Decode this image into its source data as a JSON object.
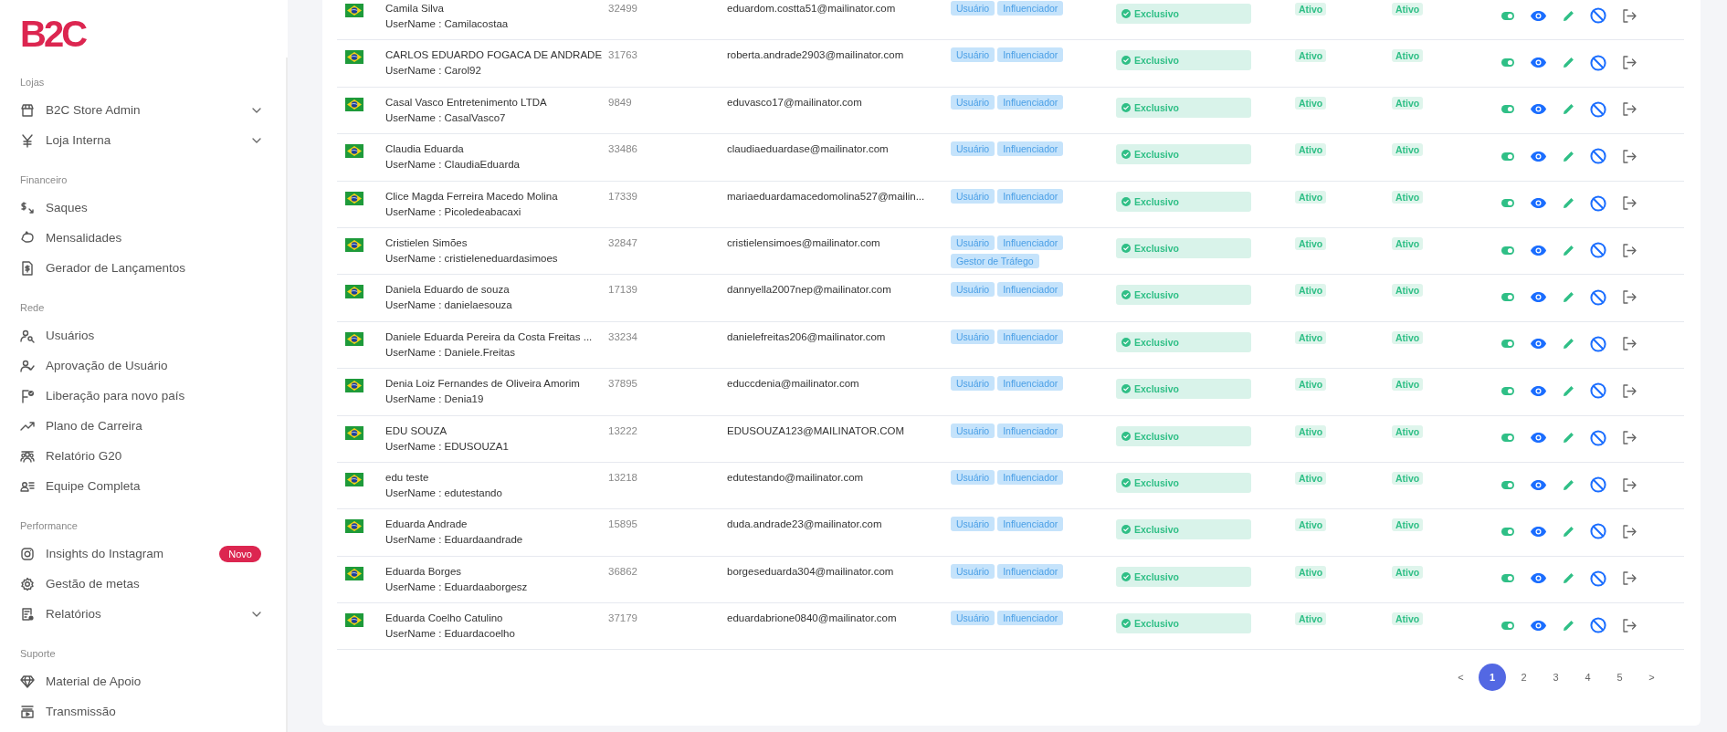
{
  "sidebar": {
    "logo": "B2C",
    "sections": [
      {
        "label": "Lojas",
        "items": [
          {
            "label": "B2C Store Admin",
            "expandable": true
          },
          {
            "label": "Loja Interna",
            "expandable": true
          }
        ]
      },
      {
        "label": "Financeiro",
        "items": [
          {
            "label": "Saques",
            "expandable": false
          },
          {
            "label": "Mensalidades",
            "expandable": false
          },
          {
            "label": "Gerador de Lançamentos",
            "expandable": false
          }
        ]
      },
      {
        "label": "Rede",
        "items": [
          {
            "label": "Usuários",
            "expandable": false
          },
          {
            "label": "Aprovação de Usuário",
            "expandable": false
          },
          {
            "label": "Liberação para novo país",
            "expandable": false
          },
          {
            "label": "Plano de Carreira",
            "expandable": false
          },
          {
            "label": "Relatório G20",
            "expandable": false
          },
          {
            "label": "Equipe Completa",
            "expandable": false
          }
        ]
      },
      {
        "label": "Performance",
        "items": [
          {
            "label": "Insights do Instagram",
            "expandable": false,
            "badge": "Novo"
          },
          {
            "label": "Gestão de metas",
            "expandable": false
          },
          {
            "label": "Relatórios",
            "expandable": true
          }
        ]
      },
      {
        "label": "Suporte",
        "items": [
          {
            "label": "Material de Apoio",
            "expandable": false
          },
          {
            "label": "Transmissão",
            "expandable": false
          }
        ]
      }
    ]
  },
  "table": {
    "rows": [
      {
        "name": "Camila Silva",
        "username": "UserName : Camilacostaa",
        "number": "32499",
        "email": "eduardom.costta51@mailinator.com",
        "roles": [
          "Usuário",
          "Influenciador"
        ],
        "label": "Exclusivo",
        "status_1": "Ativo",
        "status_2": "Ativo",
        "toggle_on": true
      },
      {
        "name": "CARLOS EDUARDO FOGACA DE ANDRADE",
        "username": "UserName : Carol92",
        "number": "31763",
        "email": "roberta.andrade2903@mailinator.com",
        "roles": [
          "Usuário",
          "Influenciador"
        ],
        "label": "Exclusivo",
        "status_1": "Ativo",
        "status_2": "Ativo",
        "toggle_on": true
      },
      {
        "name": "Casal Vasco Entretenimento LTDA",
        "username": "UserName : CasalVasco7",
        "number": "9849",
        "email": "eduvasco17@mailinator.com",
        "roles": [
          "Usuário",
          "Influenciador"
        ],
        "label": "Exclusivo",
        "status_1": "Ativo",
        "status_2": "Ativo",
        "toggle_on": true
      },
      {
        "name": "Claudia Eduarda",
        "username": "UserName : ClaudiaEduarda",
        "number": "33486",
        "email": "claudiaeduardase@mailinator.com",
        "roles": [
          "Usuário",
          "Influenciador"
        ],
        "label": "Exclusivo",
        "status_1": "Ativo",
        "status_2": "Ativo",
        "toggle_on": true
      },
      {
        "name": "Clice Magda Ferreira Macedo Molina",
        "username": "UserName : Picoledeabacaxi",
        "number": "17339",
        "email": "mariaeduardamacedomolina527@mailin...",
        "roles": [
          "Usuário",
          "Influenciador"
        ],
        "label": "Exclusivo",
        "status_1": "Ativo",
        "status_2": "Ativo",
        "toggle_on": true
      },
      {
        "name": "Cristielen Simões",
        "username": "UserName : cristieleneduardasimoes",
        "number": "32847",
        "email": "cristielensimoes@mailinator.com",
        "roles": [
          "Usuário",
          "Influenciador",
          "Gestor de Tráfego"
        ],
        "label": "Exclusivo",
        "status_1": "Ativo",
        "status_2": "Ativo",
        "toggle_on": true
      },
      {
        "name": "Daniela Eduardo de souza",
        "username": "UserName : danielaesouza",
        "number": "17139",
        "email": "dannyella2007nep@mailinator.com",
        "roles": [
          "Usuário",
          "Influenciador"
        ],
        "label": "Exclusivo",
        "status_1": "Ativo",
        "status_2": "Ativo",
        "toggle_on": true
      },
      {
        "name": "Daniele Eduarda Pereira da Costa Freitas ...",
        "username": "UserName : Daniele.Freitas",
        "number": "33234",
        "email": "danielefreitas206@mailinator.com",
        "roles": [
          "Usuário",
          "Influenciador"
        ],
        "label": "Exclusivo",
        "status_1": "Ativo",
        "status_2": "Ativo",
        "toggle_on": true
      },
      {
        "name": "Denia Loiz Fernandes de Oliveira Amorim",
        "username": "UserName : Denia19",
        "number": "37895",
        "email": "educcdenia@mailinator.com",
        "roles": [
          "Usuário",
          "Influenciador"
        ],
        "label": "Exclusivo",
        "status_1": "Ativo",
        "status_2": "Ativo",
        "toggle_on": true
      },
      {
        "name": "EDU SOUZA",
        "username": "UserName : EDUSOUZA1",
        "number": "13222",
        "email": "EDUSOUZA123@MAILINATOR.COM",
        "roles": [
          "Usuário",
          "Influenciador"
        ],
        "label": "Exclusivo",
        "status_1": "Ativo",
        "status_2": "Ativo",
        "toggle_on": true
      },
      {
        "name": "edu teste",
        "username": "UserName : edutestando",
        "number": "13218",
        "email": "edutestando@mailinator.com",
        "roles": [
          "Usuário",
          "Influenciador"
        ],
        "label": "Exclusivo",
        "status_1": "Ativo",
        "status_2": "Ativo",
        "toggle_on": true
      },
      {
        "name": "Eduarda Andrade",
        "username": "UserName : Eduardaandrade",
        "number": "15895",
        "email": "duda.andrade23@mailinator.com",
        "roles": [
          "Usuário",
          "Influenciador"
        ],
        "label": "Exclusivo",
        "status_1": "Ativo",
        "status_2": "Ativo",
        "toggle_on": true
      },
      {
        "name": "Eduarda Borges",
        "username": "UserName : Eduardaaborgesz",
        "number": "36862",
        "email": "borgeseduarda304@mailinator.com",
        "roles": [
          "Usuário",
          "Influenciador"
        ],
        "label": "Exclusivo",
        "status_1": "Ativo",
        "status_2": "Ativo",
        "toggle_on": true
      },
      {
        "name": "Eduarda Coelho Catulino",
        "username": "UserName : Eduardacoelho",
        "number": "37179",
        "email": "eduardabrione0840@mailinator.com",
        "roles": [
          "Usuário",
          "Influenciador"
        ],
        "label": "Exclusivo",
        "status_1": "Ativo",
        "status_2": "Ativo",
        "toggle_on": true
      }
    ]
  },
  "pagination": {
    "previous": "<",
    "pages": [
      {
        "label": "1",
        "selected": true
      },
      {
        "label": "2",
        "selected": false
      },
      {
        "label": "3",
        "selected": false
      },
      {
        "label": "4",
        "selected": false
      },
      {
        "label": "5",
        "selected": false
      }
    ],
    "next": ">"
  }
}
